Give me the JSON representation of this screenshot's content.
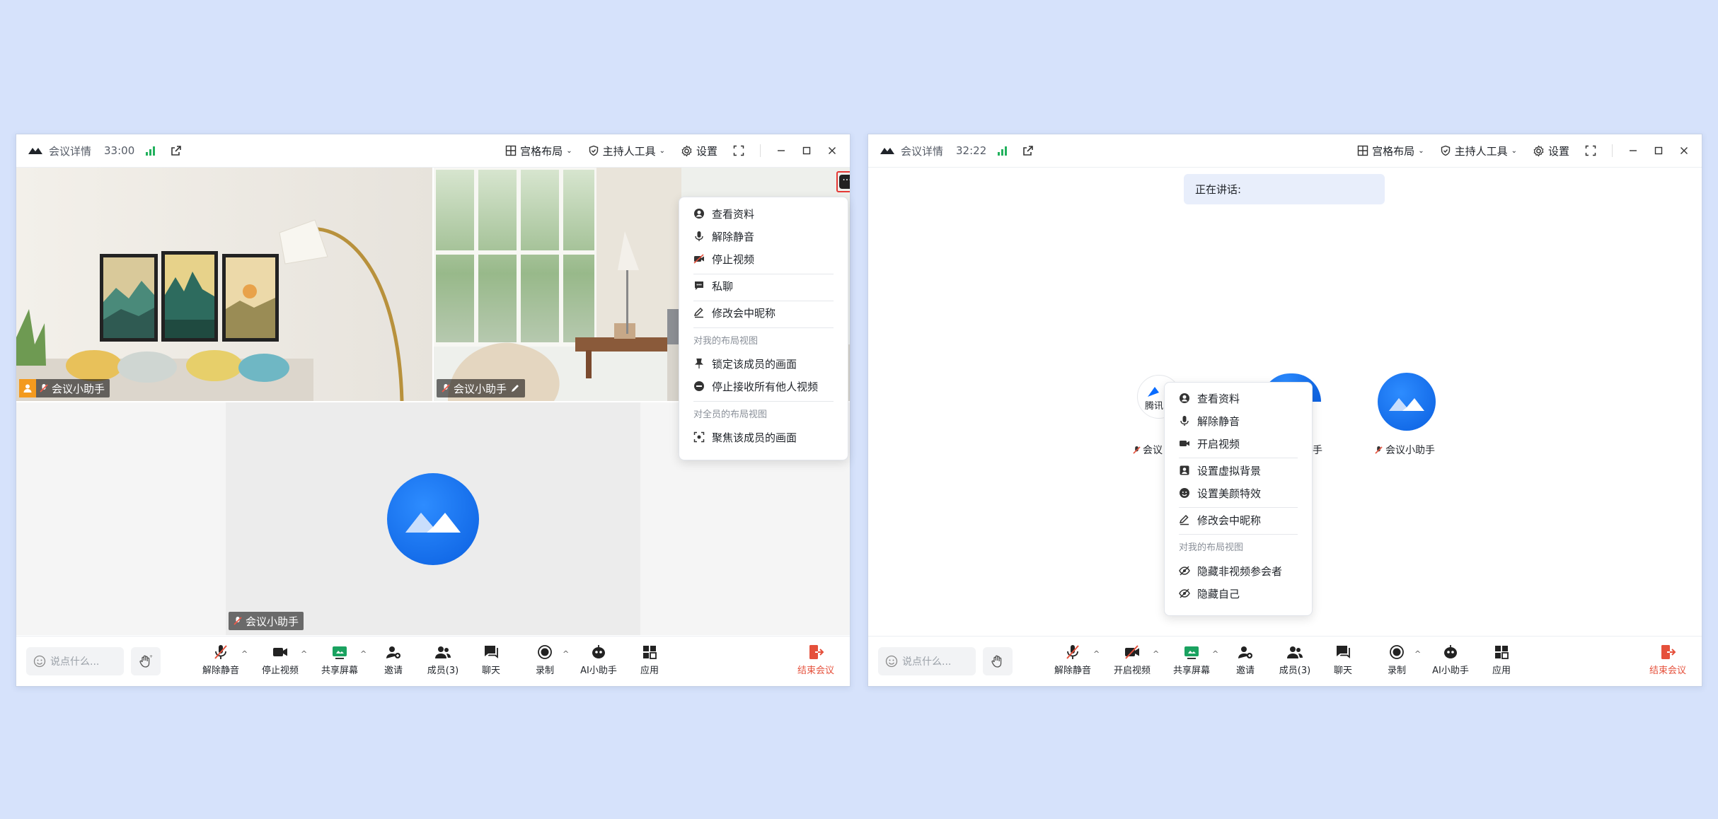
{
  "left": {
    "title": "会议详情",
    "duration": "33:00",
    "header": {
      "grid_layout": "宫格布局",
      "host_tools": "主持人工具",
      "settings": "设置"
    },
    "tiles": [
      {
        "name": "会议小助手"
      },
      {
        "name": "会议小助手"
      },
      {
        "name": "会议小助手"
      }
    ],
    "menu": {
      "items_top": [
        "查看资料",
        "解除静音",
        "停止视频"
      ],
      "private_chat": "私聊",
      "rename": "修改会中昵称",
      "section_mine": "对我的布局视图",
      "lock": "锁定该成员的画面",
      "stop_receive": "停止接收所有他人视频",
      "section_all": "对全员的布局视图",
      "focus": "聚焦该成员的画面"
    },
    "toolbar": {
      "chat_placeholder": "说点什么...",
      "unmute": "解除静音",
      "video": "停止视频",
      "share": "共享屏幕",
      "invite": "邀请",
      "members": "成员(3)",
      "chat": "聊天",
      "record": "录制",
      "ai": "AI小助手",
      "apps": "应用",
      "end": "结束会议"
    }
  },
  "right": {
    "title": "会议详情",
    "duration": "32:22",
    "header": {
      "grid_layout": "宫格布局",
      "host_tools": "主持人工具",
      "settings": "设置"
    },
    "speaking": "正在讲话:",
    "participants": [
      {
        "name": "会议",
        "logo_text": "腾讯"
      },
      {
        "name": "会议小助手"
      }
    ],
    "partial_label": "手",
    "menu": {
      "items_top": [
        "查看资料",
        "解除静音",
        "开启视频"
      ],
      "virtual_bg": "设置虚拟背景",
      "beauty": "设置美颜特效",
      "rename": "修改会中昵称",
      "section_mine": "对我的布局视图",
      "hide_novideo": "隐藏非视频参会者",
      "hide_self": "隐藏自己"
    },
    "toolbar": {
      "chat_placeholder": "说点什么...",
      "unmute": "解除静音",
      "video": "开启视频",
      "share": "共享屏幕",
      "invite": "邀请",
      "members": "成员(3)",
      "chat": "聊天",
      "record": "录制",
      "ai": "AI小助手",
      "apps": "应用",
      "end": "结束会议"
    }
  },
  "colors": {
    "accent": "#0a6cff",
    "signal": "#22b15d",
    "end": "#e5503b",
    "highlight": "#e53935"
  }
}
